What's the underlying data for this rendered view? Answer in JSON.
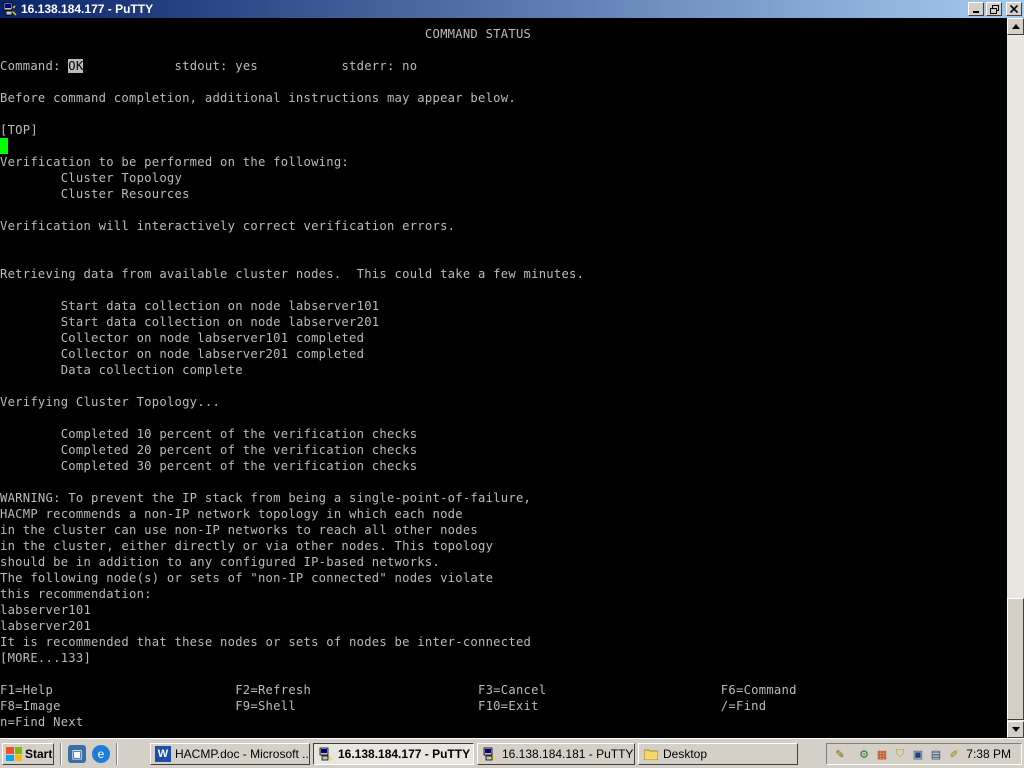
{
  "window": {
    "title": "16.138.184.177 - PuTTY",
    "buttons": [
      "minimize",
      "maximize",
      "close"
    ]
  },
  "terminal": {
    "lines": [
      {
        "row": 1,
        "text": "                                                        COMMAND STATUS"
      },
      {
        "row": 3,
        "text": "Command: ",
        "highlight": "OK",
        "rest": "            stdout: yes           stderr: no"
      },
      {
        "row": 5,
        "text": "Before command completion, additional instructions may appear below."
      },
      {
        "row": 7,
        "text": "[TOP]"
      },
      {
        "row": 9,
        "text": "Verification to be performed on the following:"
      },
      {
        "row": 10,
        "text": "        Cluster Topology"
      },
      {
        "row": 11,
        "text": "        Cluster Resources"
      },
      {
        "row": 13,
        "text": "Verification will interactively correct verification errors."
      },
      {
        "row": 16,
        "text": "Retrieving data from available cluster nodes.  This could take a few minutes."
      },
      {
        "row": 18,
        "text": "        Start data collection on node labserver101"
      },
      {
        "row": 19,
        "text": "        Start data collection on node labserver201"
      },
      {
        "row": 20,
        "text": "        Collector on node labserver101 completed"
      },
      {
        "row": 21,
        "text": "        Collector on node labserver201 completed"
      },
      {
        "row": 22,
        "text": "        Data collection complete"
      },
      {
        "row": 24,
        "text": "Verifying Cluster Topology..."
      },
      {
        "row": 26,
        "text": "        Completed 10 percent of the verification checks"
      },
      {
        "row": 27,
        "text": "        Completed 20 percent of the verification checks"
      },
      {
        "row": 28,
        "text": "        Completed 30 percent of the verification checks"
      },
      {
        "row": 30,
        "text": "WARNING: To prevent the IP stack from being a single-point-of-failure,"
      },
      {
        "row": 31,
        "text": "HACMP recommends a non-IP network topology in which each node"
      },
      {
        "row": 32,
        "text": "in the cluster can use non-IP networks to reach all other nodes"
      },
      {
        "row": 33,
        "text": "in the cluster, either directly or via other nodes. This topology"
      },
      {
        "row": 34,
        "text": "should be in addition to any configured IP-based networks."
      },
      {
        "row": 35,
        "text": "The following node(s) or sets of \"non-IP connected\" nodes violate"
      },
      {
        "row": 36,
        "text": "this recommendation:"
      },
      {
        "row": 37,
        "text": "labserver101"
      },
      {
        "row": 38,
        "text": "labserver201"
      },
      {
        "row": 39,
        "text": "It is recommended that these nodes or sets of nodes be inter-connected"
      },
      {
        "row": 40,
        "text": "[MORE...133]"
      },
      {
        "row": 42,
        "text": "F1=Help                        F2=Refresh                      F3=Cancel                       F6=Command"
      },
      {
        "row": 43,
        "text": "F8=Image                       F9=Shell                        F10=Exit                        /=Find"
      },
      {
        "row": 44,
        "text": "n=Find Next"
      }
    ]
  },
  "taskbar": {
    "start_label": "Start",
    "quick_launch": [
      "show-desktop-icon",
      "internet-explorer-icon"
    ],
    "tasks": [
      {
        "label": "HACMP.doc - Microsoft ...",
        "icon": "word-icon",
        "active": false
      },
      {
        "label": "16.138.184.177 - PuTTY",
        "icon": "putty-icon",
        "active": true
      },
      {
        "label": "16.138.184.181 - PuTTY",
        "icon": "putty-icon",
        "active": false
      },
      {
        "label": "Desktop",
        "icon": "folder-icon",
        "active": false
      }
    ],
    "clock": "7:38 PM"
  },
  "colors": {
    "terminal_bg": "#000000",
    "terminal_fg": "#bbbbbb",
    "cursor": "#00ff00",
    "titlebar_start": "#0a246a",
    "titlebar_end": "#a6caf0",
    "chrome": "#d4d0c8"
  }
}
